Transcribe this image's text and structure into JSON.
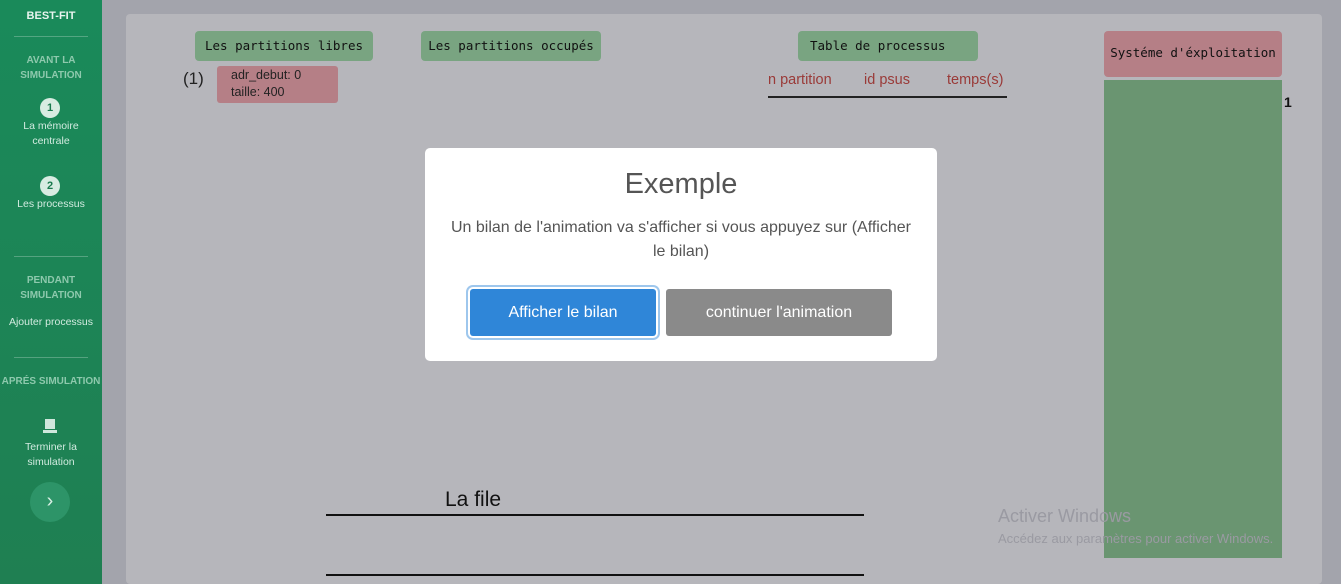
{
  "sidebar": {
    "brand": "BEST-FIT",
    "section_before": "AVANT LA SIMULATION",
    "step1": {
      "number": "1",
      "label": "La mémoire centrale"
    },
    "step2": {
      "number": "2",
      "label": "Les processus"
    },
    "section_during": "PENDANT SIMULATION",
    "add_process": "Ajouter processus",
    "section_after": "APRÉS SIMULATION",
    "finish": "Terminer la simulation",
    "next_icon": "chevron-right-icon",
    "finish_icon": "stop-icon"
  },
  "main": {
    "free_partitions_label": "Les partitions libres",
    "occupied_partitions_label": "Les partitions occupés",
    "process_table_label": "Table de processus",
    "os_label": "Systéme d'éxploitation",
    "free_partition": {
      "index": "(1)",
      "start": "adr_debut: 0",
      "size": "taille: 400"
    },
    "process_table_headers": [
      "n partition",
      "id psus",
      "temps(s)"
    ],
    "os_marker": "1",
    "queue_label": "La file"
  },
  "modal": {
    "title": "Exemple",
    "text": "Un bilan de l'animation va s'afficher si vous appuyez sur (Afficher le bilan)",
    "primary_button": "Afficher le bilan",
    "secondary_button": "continuer l'animation"
  },
  "watermark": {
    "title": "Activer Windows",
    "subtitle": "Accédez aux paramètres pour activer Windows."
  },
  "colors": {
    "sidebar": "#1a8a5a",
    "tag_green": "#79a481",
    "tag_pink": "#b57f86",
    "primary": "#2f86d8",
    "secondary": "#8a8a8a"
  }
}
